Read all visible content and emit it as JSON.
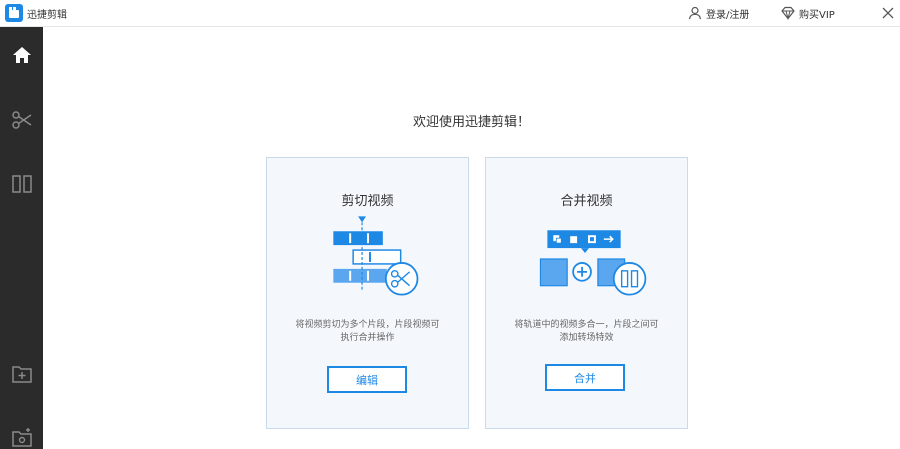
{
  "app": {
    "title": "迅捷剪辑",
    "login_label": "登录/注册",
    "vip_label": "购买VIP"
  },
  "sidebar": {
    "items": [
      {
        "name": "home",
        "icon": "home-icon",
        "active": true
      },
      {
        "name": "cut",
        "icon": "scissors-icon"
      },
      {
        "name": "split",
        "icon": "split-panels-icon"
      },
      {
        "name": "add",
        "icon": "add-file-icon"
      },
      {
        "name": "settings",
        "icon": "folder-gear-icon"
      }
    ]
  },
  "main": {
    "welcome": "欢迎使用迅捷剪辑！",
    "cards": [
      {
        "title": "剪切视频",
        "desc_line1": "将视频剪切为多个片段，片段视频可",
        "desc_line2": "执行合并操作",
        "button": "编辑"
      },
      {
        "title": "合并视频",
        "desc_line1": "将轨道中的视频多合一，片段之间可",
        "desc_line2": "添加转场特效",
        "button": "合并"
      }
    ]
  },
  "colors": {
    "accent": "#1e88e5",
    "sidebar_bg": "#2b2b2b",
    "card_bg": "#f4f8fc",
    "card_border": "#c9daea"
  }
}
